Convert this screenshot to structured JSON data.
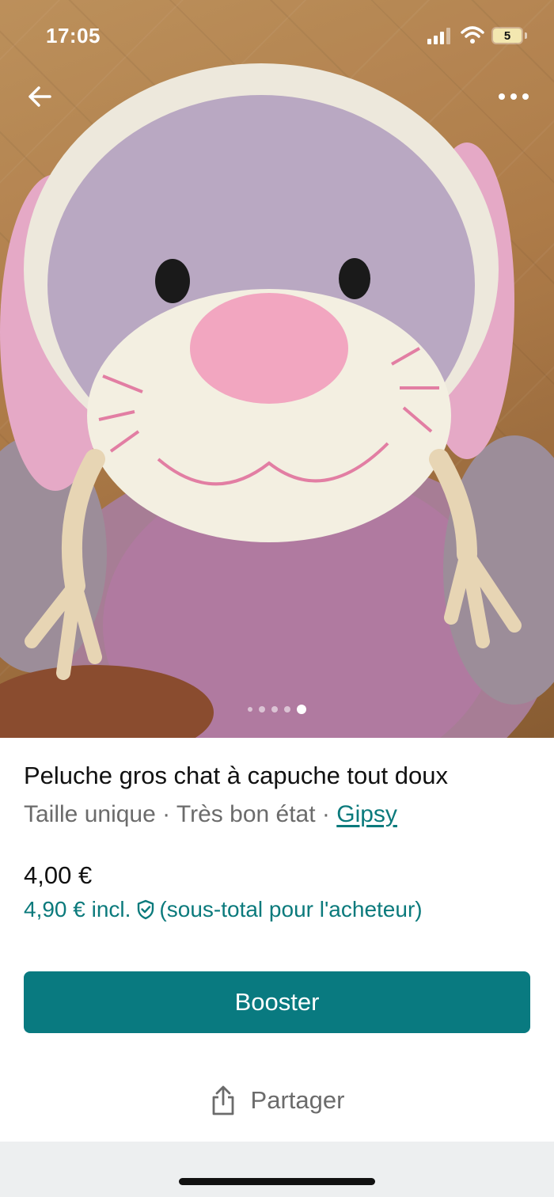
{
  "status_bar": {
    "time": "17:05",
    "battery_level": "5"
  },
  "photo": {
    "dots_count": 5,
    "active_index": 4
  },
  "icons": {
    "back": "arrow-left-icon",
    "more": "more-dots-icon",
    "shield": "shield-check-icon",
    "share": "share-icon"
  },
  "item": {
    "title": "Peluche gros chat à capuche tout doux",
    "size": "Taille unique",
    "condition": "Très bon état",
    "separator": " · ",
    "brand": "Gipsy",
    "price": "4,00 €",
    "buyer_price": "4,90 € incl.",
    "buyer_note": "(sous-total pour l'acheteur)"
  },
  "actions": {
    "booster_label": "Booster",
    "share_label": "Partager"
  },
  "colors": {
    "accent": "#097a80",
    "link": "#0b7a7c",
    "muted_text": "#6b6b6b",
    "bottom_band": "#edeff0"
  }
}
